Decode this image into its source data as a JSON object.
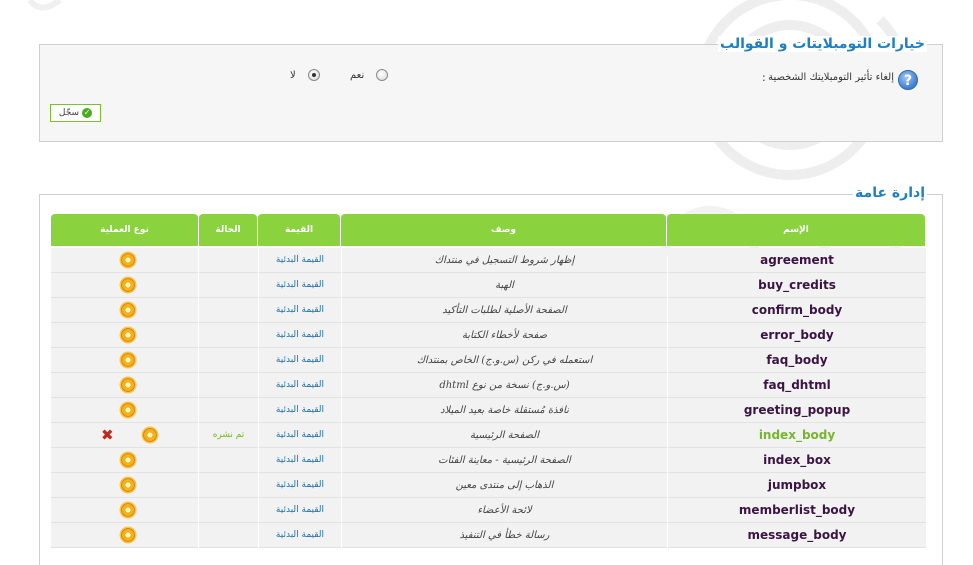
{
  "section_options": {
    "title": "خيارات التومبلايتات و القوالب",
    "option_label": "إلغاء تأثير التومبلايتك الشخصية",
    "colon": ":",
    "yes_label": "نعم",
    "no_label": "لا",
    "selected": "no",
    "save_label": "سجّل"
  },
  "section_admin": {
    "title": "إدارة عامة",
    "headers": {
      "name": "الإسم",
      "description": "وصف",
      "value": "القيمة",
      "state": "الحالة",
      "action": "نوع العملية"
    },
    "rows": [
      {
        "name": "agreement",
        "description": "إظهار شروط التسجيل في منتداك",
        "value": "القيمة البدئية",
        "state": "",
        "highlight": false,
        "delete": false
      },
      {
        "name": "buy_credits",
        "description": "الهبة",
        "value": "القيمة البدئية",
        "state": "",
        "highlight": false,
        "delete": false
      },
      {
        "name": "confirm_body",
        "description": "الصفحة الأصلية لطلبات التأكيد",
        "value": "القيمة البدئية",
        "state": "",
        "highlight": false,
        "delete": false
      },
      {
        "name": "error_body",
        "description": "صفحة لأخطاء الكتابة",
        "value": "القيمة البدئية",
        "state": "",
        "highlight": false,
        "delete": false
      },
      {
        "name": "faq_body",
        "description": "استعمله في ركن (س.و.ج) الخاص بمنتداك",
        "value": "القيمة البدئية",
        "state": "",
        "highlight": false,
        "delete": false
      },
      {
        "name": "faq_dhtml",
        "description": "(س.و.ج) نسخة من نوع dhtml",
        "value": "القيمة البدئية",
        "state": "",
        "highlight": false,
        "delete": false
      },
      {
        "name": "greeting_popup",
        "description": "نافذة مُستقلة خاصة بعيد الميلاد",
        "value": "القيمة البدئية",
        "state": "",
        "highlight": false,
        "delete": false
      },
      {
        "name": "index_body",
        "description": "الصفحة الرئيسية",
        "value": "القيمة البدئية",
        "state": "تم نشره",
        "highlight": true,
        "delete": true
      },
      {
        "name": "index_box",
        "description": "الصفحة الرئيسية - معاينة الفئات",
        "value": "القيمة البدئية",
        "state": "",
        "highlight": false,
        "delete": false
      },
      {
        "name": "jumpbox",
        "description": "الذهاب إلى منتدى معين",
        "value": "القيمة البدئية",
        "state": "",
        "highlight": false,
        "delete": false
      },
      {
        "name": "memberlist_body",
        "description": "لائحة الأعضاء",
        "value": "القيمة البدئية",
        "state": "",
        "highlight": false,
        "delete": false
      },
      {
        "name": "message_body",
        "description": "رسالة خطأ في التنفيذ",
        "value": "القيمة البدئية",
        "state": "",
        "highlight": false,
        "delete": false
      }
    ]
  },
  "colors": {
    "accent_green": "#8bd23f",
    "title_blue": "#1e7fc1",
    "name_purple": "#3a1442",
    "link_blue": "#1e6fa8"
  },
  "icons": {
    "help": "question-circle-icon",
    "save": "check-circle-icon",
    "edit": "gear-icon",
    "delete": "x-icon"
  }
}
